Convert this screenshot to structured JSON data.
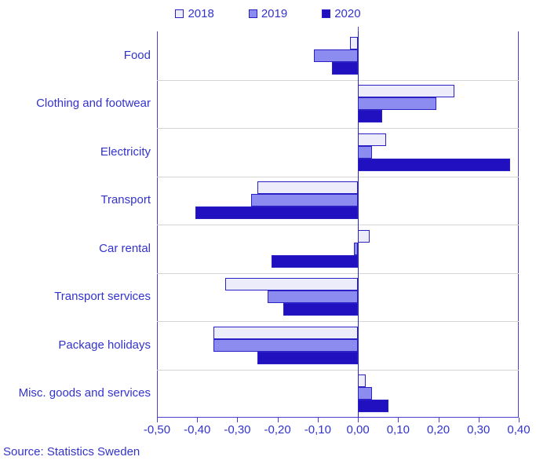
{
  "legend": {
    "entries": [
      {
        "label": "2018",
        "color": "#ececfb"
      },
      {
        "label": "2019",
        "color": "#8b8bf0"
      },
      {
        "label": "2020",
        "color": "#2010c0"
      }
    ]
  },
  "source": {
    "text": "Source: Statistics Sweden"
  },
  "axis": {
    "tick_labels": [
      "-0,50",
      "-0,40",
      "-0,30",
      "-0,20",
      "-0,10",
      "0,00",
      "0,10",
      "0,20",
      "0,30",
      "0,40"
    ]
  },
  "chart_data": {
    "type": "bar",
    "orientation": "horizontal",
    "title": "",
    "subtitle": "",
    "xlabel": "",
    "ylabel": "",
    "xlim": [
      -0.5,
      0.4
    ],
    "xticks": [
      -0.5,
      -0.4,
      -0.3,
      -0.2,
      -0.1,
      0.0,
      0.1,
      0.2,
      0.3,
      0.4
    ],
    "xtick_labels": [
      "-0,50",
      "-0,40",
      "-0,30",
      "-0,20",
      "-0,10",
      "0,00",
      "0,10",
      "0,20",
      "0,30",
      "0,40"
    ],
    "grid": false,
    "legend_position": "top-center",
    "source_note": "Source: Statistics Sweden",
    "categories": [
      "Food",
      "Clothing and footwear",
      "Electricity",
      "Transport",
      "Car rental",
      "Transport services",
      "Package holidays",
      "Misc. goods and services"
    ],
    "series": [
      {
        "name": "2018",
        "color": "#ececfb",
        "values": [
          -0.02,
          0.24,
          0.07,
          -0.25,
          0.03,
          -0.33,
          -0.36,
          0.02
        ]
      },
      {
        "name": "2019",
        "color": "#8b8bf0",
        "values": [
          -0.11,
          0.195,
          0.035,
          -0.265,
          -0.01,
          -0.225,
          -0.36,
          0.035
        ]
      },
      {
        "name": "2020",
        "color": "#2010c0",
        "values": [
          -0.065,
          0.06,
          0.378,
          -0.405,
          -0.215,
          -0.185,
          -0.25,
          0.075
        ]
      }
    ]
  }
}
